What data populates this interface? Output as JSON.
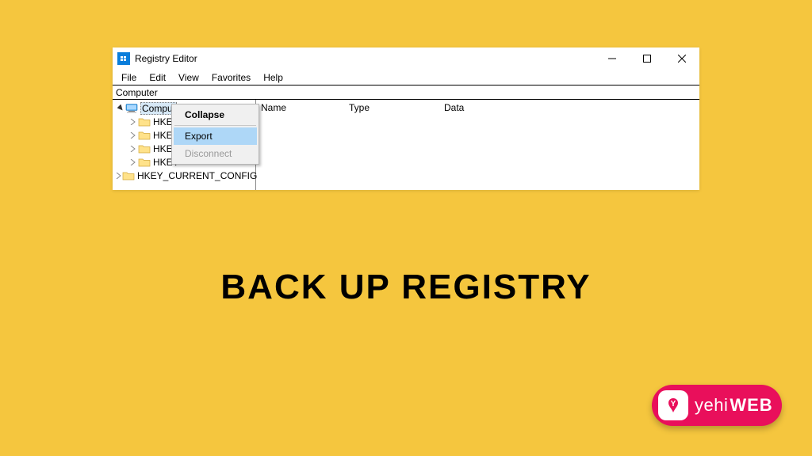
{
  "window": {
    "title": "Registry Editor",
    "minimize_tip": "Minimize",
    "maximize_tip": "Maximize",
    "close_tip": "Close"
  },
  "menubar": {
    "file": "File",
    "edit": "Edit",
    "view": "View",
    "favorites": "Favorites",
    "help": "Help"
  },
  "addressbar": {
    "path": "Computer"
  },
  "tree": {
    "root": "Comput",
    "items": [
      "HKEY",
      "HKEY",
      "HKEY",
      "HKEY",
      "HKEY_CURRENT_CONFIG"
    ]
  },
  "columns": {
    "name": "Name",
    "type": "Type",
    "data": "Data"
  },
  "context_menu": {
    "collapse": "Collapse",
    "export": "Export",
    "disconnect": "Disconnect"
  },
  "caption": "BACK UP REGISTRY",
  "logo": {
    "text1": "yehi",
    "text2": "WEB"
  }
}
